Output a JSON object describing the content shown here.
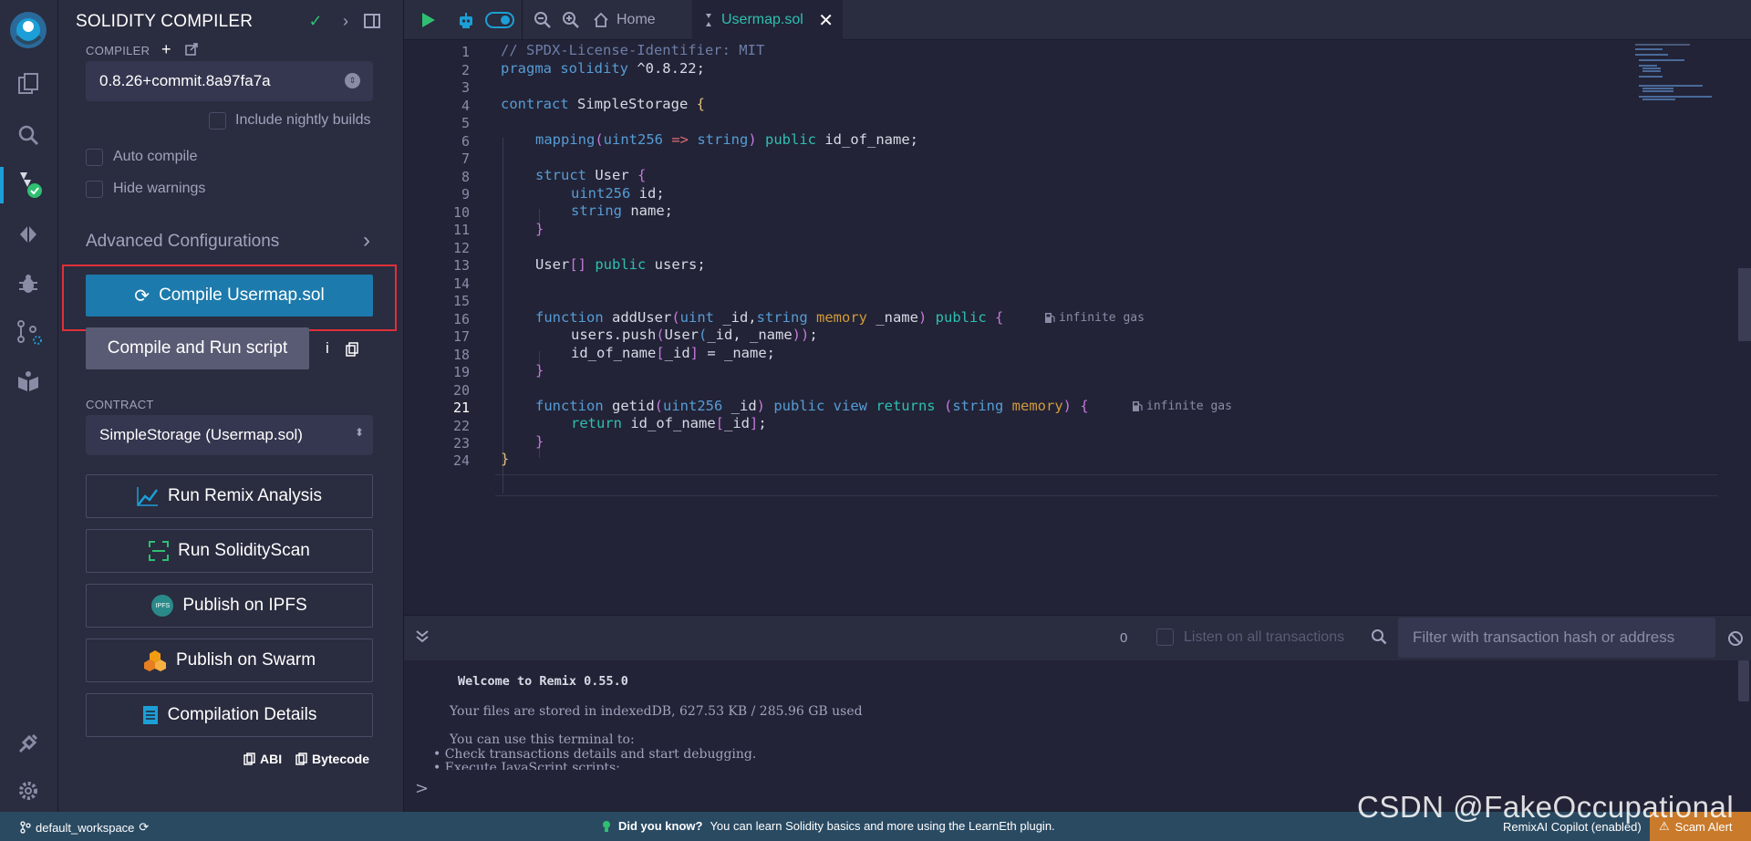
{
  "panel": {
    "title": "SOLIDITY COMPILER",
    "compiler_label": "COMPILER",
    "compiler_version": "0.8.26+commit.8a97fa7a",
    "include_nightly": "Include nightly builds",
    "auto_compile": "Auto compile",
    "hide_warnings": "Hide warnings",
    "advanced": "Advanced Configurations",
    "compile_button": "Compile Usermap.sol",
    "compile_run_button": "Compile and Run script",
    "info": "i",
    "contract_label": "CONTRACT",
    "contract_value": "SimpleStorage (Usermap.sol)",
    "run_remix_analysis": "Run Remix Analysis",
    "run_solidityscan": "Run SolidityScan",
    "publish_ipfs": "Publish on IPFS",
    "ipfs_badge": "IPFS",
    "publish_swarm": "Publish on Swarm",
    "compilation_details": "Compilation Details",
    "abi": "ABI",
    "bytecode": "Bytecode"
  },
  "topbar": {
    "home_tab": "Home",
    "file_tab": "Usermap.sol"
  },
  "editor": {
    "line_numbers": [
      "1",
      "2",
      "3",
      "4",
      "5",
      "6",
      "7",
      "8",
      "9",
      "10",
      "11",
      "12",
      "13",
      "14",
      "15",
      "16",
      "17",
      "18",
      "19",
      "20",
      "21",
      "22",
      "23",
      "24"
    ],
    "lines": {
      "l1": "// SPDX-License-Identifier: MIT",
      "l2_kw": "pragma solidity",
      "l2_rest": " ^0.8.22;",
      "l4_kw": "contract",
      "l4_rest": " SimpleStorage ",
      "l4_brace": "{",
      "l6_a": "mapping",
      "l6_b": "(",
      "l6_c": "uint256",
      "l6_d": " => ",
      "l6_e": "string",
      "l6_f": ") ",
      "l6_g": "public",
      "l6_h": " id_of_name;",
      "l8_kw": "struct",
      "l8_rest": " User ",
      "l8_brace": "{",
      "l9_ty": "uint256",
      "l9_rest": " id;",
      "l10_ty": "string",
      "l10_rest": " name;",
      "l11": "}",
      "l13_a": "User",
      "l13_b": "[] ",
      "l13_c": "public",
      "l13_d": " users;",
      "l16_a": "function",
      "l16_b": " addUser",
      "l16_c": "(",
      "l16_d": "uint",
      "l16_e": " _id,",
      "l16_f": "string",
      "l16_g": " memory",
      "l16_h": " _name",
      "l16_i": ") ",
      "l16_j": "public",
      "l16_k": " {",
      "l17_a": "users.push",
      "l17_b": "(",
      "l17_c": "User",
      "l17_d": "(",
      "l17_e": "_id, _name",
      "l17_f": "))",
      "l17_g": ";",
      "l18_a": "id_of_name",
      "l18_b": "[",
      "l18_c": "_id",
      "l18_d": "]",
      "l18_e": " = _name;",
      "l19": "}",
      "l21_a": "function",
      "l21_b": " getid",
      "l21_c": "(",
      "l21_d": "uint256",
      "l21_e": " _id",
      "l21_f": ") ",
      "l21_g": "public view",
      "l21_h": " returns ",
      "l21_i": "(",
      "l21_j": "string",
      "l21_k": " memory",
      "l21_l": ") ",
      "l21_m": "{",
      "l22_a": "return",
      "l22_b": " id_of_name",
      "l22_c": "[",
      "l22_d": "_id",
      "l22_e": "]",
      "l22_f": ";",
      "l23": "}",
      "l24": "}"
    },
    "gas_label": "infinite gas"
  },
  "terminal": {
    "tx_count": "0",
    "listen_label": "Listen on all transactions",
    "filter_placeholder": "Filter with transaction hash or address",
    "welcome": "Welcome to Remix 0.55.0",
    "storage": "Your files are stored in indexedDB, 627.53 KB / 285.96 GB used",
    "use_terminal": "You can use this terminal to:",
    "bullet1": "Check transactions details and start debugging.",
    "bullet2": "Execute JavaScript scripts:",
    "prompt": ">"
  },
  "status": {
    "workspace": "default_workspace",
    "did_you_know": "Did you know?",
    "tip": "You can learn Solidity basics and more using the LearnEth plugin.",
    "ai": "RemixAI Copilot (enabled)",
    "scam": "Scam Alert"
  },
  "watermark": "CSDN @FakeOccupational",
  "colors": {
    "accent": "#1d7aac",
    "teal": "#2fbfb1",
    "highlight": "#e0303a"
  }
}
